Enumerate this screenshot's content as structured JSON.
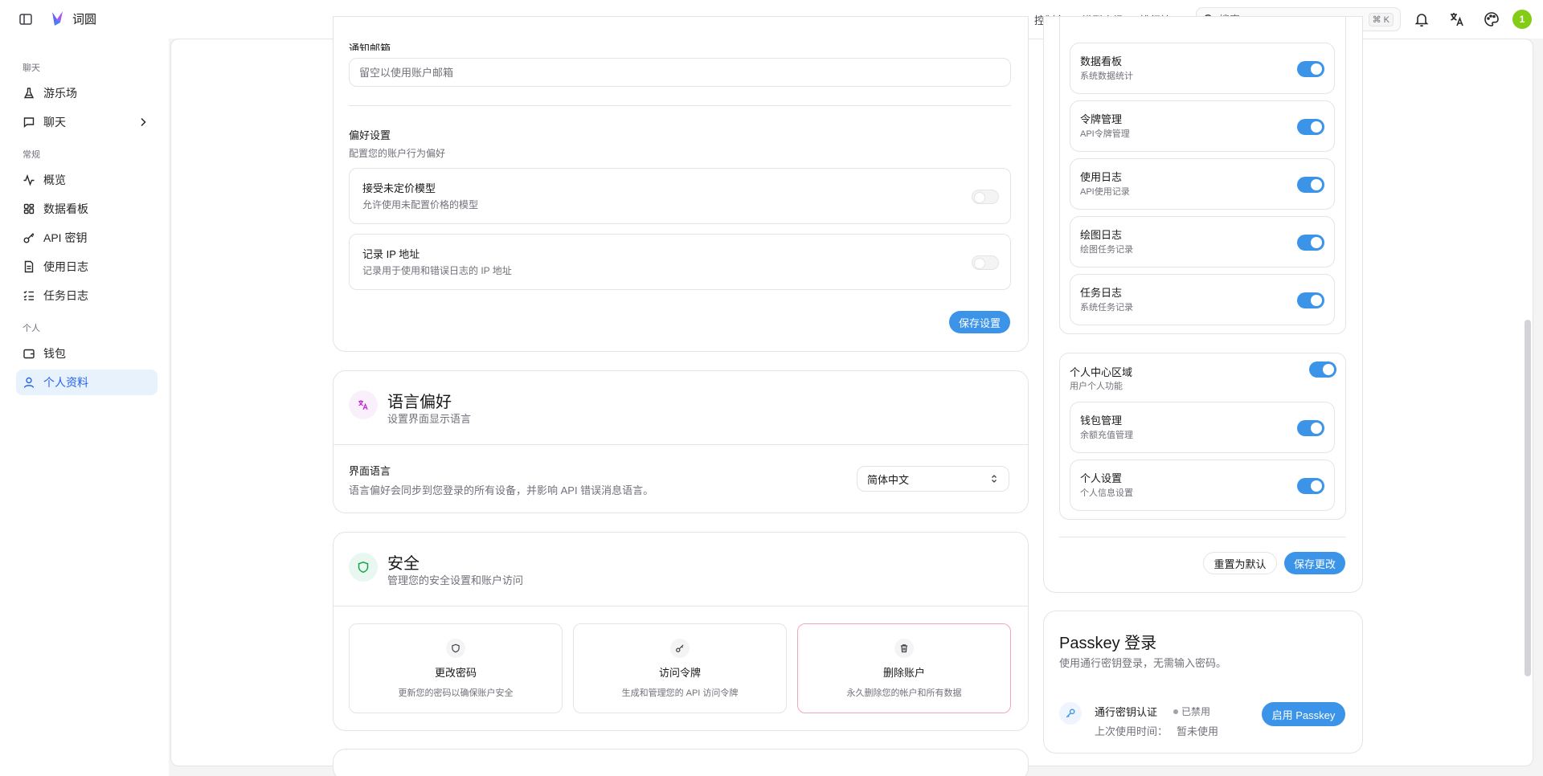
{
  "topbar": {
    "brand": "词圆",
    "links": [
      "控制台",
      "模型广场",
      "排行榜"
    ],
    "search_placeholder": "搜索",
    "search_kbd": "⌘ K",
    "avatar_initial": "1"
  },
  "sidebar": {
    "sections": {
      "chat": "聊天",
      "general": "常规",
      "personal": "个人"
    },
    "items": {
      "playground": "游乐场",
      "chat": "聊天",
      "overview": "概览",
      "dashboard": "数据看板",
      "api_keys": "API 密钥",
      "usage_logs": "使用日志",
      "task_logs": "任务日志",
      "wallet": "钱包",
      "profile": "个人资料"
    }
  },
  "notify": {
    "label": "通知邮箱",
    "placeholder": "留空以使用账户邮箱"
  },
  "prefs": {
    "title": "偏好设置",
    "subtitle": "配置您的账户行为偏好",
    "rows": [
      {
        "title": "接受未定价模型",
        "desc": "允许使用未配置价格的模型",
        "enabled": false
      },
      {
        "title": "记录 IP 地址",
        "desc": "记录用于使用和错误日志的 IP 地址",
        "enabled": false
      }
    ],
    "save": "保存设置"
  },
  "language": {
    "title": "语言偏好",
    "subtitle": "设置界面显示语言",
    "label": "界面语言",
    "desc": "语言偏好会同步到您登录的所有设备，并影响 API 错误消息语言。",
    "selected": "简体中文"
  },
  "security": {
    "title": "安全",
    "subtitle": "管理您的安全设置和账户访问",
    "tiles": [
      {
        "title": "更改密码",
        "desc": "更新您的密码以确保账户安全"
      },
      {
        "title": "访问令牌",
        "desc": "生成和管理您的 API 访问令牌"
      },
      {
        "title": "删除账户",
        "desc": "永久删除您的帐户和所有数据"
      }
    ]
  },
  "modules": {
    "top_items": [
      {
        "name": "数据看板",
        "desc": "系统数据统计",
        "enabled": true
      },
      {
        "name": "令牌管理",
        "desc": "API令牌管理",
        "enabled": true
      },
      {
        "name": "使用日志",
        "desc": "API使用记录",
        "enabled": true
      },
      {
        "name": "绘图日志",
        "desc": "绘图任务记录",
        "enabled": true
      },
      {
        "name": "任务日志",
        "desc": "系统任务记录",
        "enabled": true
      }
    ],
    "personal_group": {
      "title": "个人中心区域",
      "desc": "用户个人功能",
      "enabled": true
    },
    "personal_items": [
      {
        "name": "钱包管理",
        "desc": "余额充值管理",
        "enabled": true
      },
      {
        "name": "个人设置",
        "desc": "个人信息设置",
        "enabled": true
      }
    ],
    "reset": "重置为默认",
    "save": "保存更改"
  },
  "passkey": {
    "title": "Passkey 登录",
    "subtitle": "使用通行密钥登录，无需输入密码。",
    "item": "通行密钥认证",
    "status": "已禁用",
    "last_used_label": "上次使用时间：",
    "last_used_value": "暂未使用",
    "enable": "启用 Passkey"
  },
  "colors": {
    "accent": "#3b94e8",
    "active_bg": "#e8f2fd",
    "danger_border": "#f4a7b6"
  }
}
